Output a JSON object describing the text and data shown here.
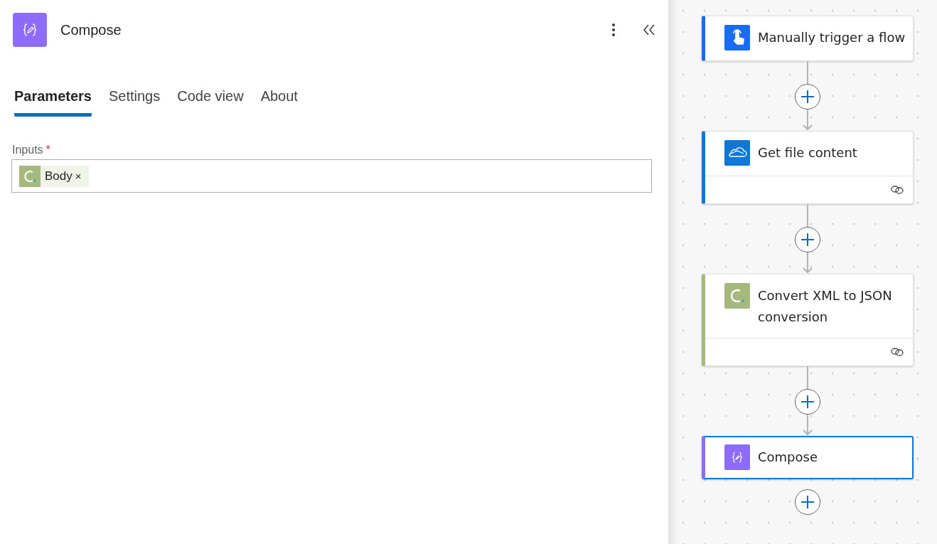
{
  "panel": {
    "title": "Compose",
    "tabs": [
      {
        "label": "Parameters",
        "selected": true
      },
      {
        "label": "Settings",
        "selected": false
      },
      {
        "label": "Code view",
        "selected": false
      },
      {
        "label": "About",
        "selected": false
      }
    ],
    "field": {
      "label": "Inputs",
      "required_mark": "*",
      "tokens": [
        {
          "kind": "converter",
          "label": "Body",
          "remove": "×"
        }
      ]
    }
  },
  "flow": {
    "nodes": [
      {
        "kind": "trigger",
        "title": "Manually trigger a flow",
        "color": "#1a6cf5",
        "selected": false,
        "has_link": false
      },
      {
        "kind": "onedrive",
        "title": "Get file content",
        "color": "#0f78d4",
        "selected": false,
        "has_link": true
      },
      {
        "kind": "converter",
        "title": "Convert XML to JSON conversion",
        "color": "#a4b97b",
        "selected": false,
        "has_link": true
      },
      {
        "kind": "compose",
        "title": "Compose",
        "color": "#8c6cf8",
        "selected": true,
        "has_link": false
      }
    ]
  }
}
